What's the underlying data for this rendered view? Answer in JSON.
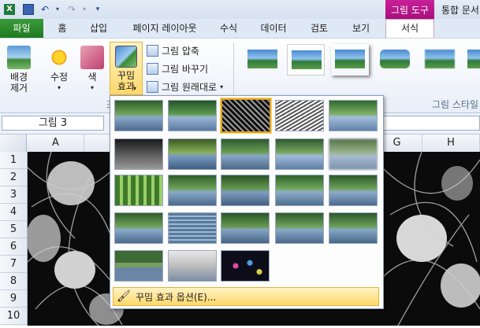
{
  "title_bar": {
    "context_tab": "그림 도구",
    "title_text": "통합 문서"
  },
  "tabs": [
    {
      "label": "파일"
    },
    {
      "label": "홈"
    },
    {
      "label": "삽입"
    },
    {
      "label": "페이지 레이아웃"
    },
    {
      "label": "수식"
    },
    {
      "label": "데이터"
    },
    {
      "label": "검토"
    },
    {
      "label": "보기"
    },
    {
      "label": "서식"
    }
  ],
  "ribbon": {
    "remove_bg": "배경\n제거",
    "corrections": "수정",
    "color": "색",
    "artistic_effects": "꾸밈\n효과",
    "compress": "그림 압축",
    "change": "그림 바꾸기",
    "reset": "그림 원래대로",
    "styles_group_label": "그림 스타일",
    "adjust_group_hint": "조"
  },
  "name_box": {
    "value": "그림 3"
  },
  "columns": [
    "A",
    "G",
    "H"
  ],
  "rows": [
    "1",
    "2",
    "3",
    "4",
    "5",
    "6",
    "7",
    "8",
    "9",
    "10"
  ],
  "gallery": {
    "footer_label": "꾸밈 효과 옵션(E)...",
    "effects": [
      "none",
      "marker",
      "pencil-grayscale",
      "pencil-sketch",
      "line-drawing",
      "chalk-sketch",
      "paint-strokes",
      "paint-brush",
      "glow-diffused",
      "blur",
      "light-screen",
      "watercolor-sponge",
      "film-grain",
      "mosaic-bubbles",
      "glass",
      "cement",
      "texturizer",
      "crisscross-etching",
      "pastels-smooth",
      "plastic-wrap",
      "cutout",
      "photocopy",
      "glow-edges"
    ],
    "selected_index": 2
  },
  "colors": {
    "file_tab": "#2a8a2a",
    "context_tab": "#b8178a",
    "selection": "#e3a21a"
  }
}
